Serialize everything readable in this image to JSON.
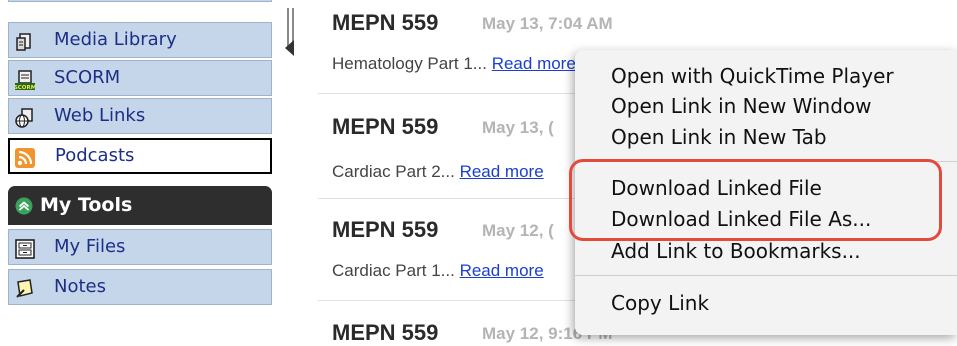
{
  "sidebar": {
    "items": [
      {
        "label": "Media Library",
        "icon": "media-library-icon"
      },
      {
        "label": "SCORM",
        "icon": "scorm-icon"
      },
      {
        "label": "Web Links",
        "icon": "web-links-icon"
      },
      {
        "label": "Podcasts",
        "icon": "rss-icon"
      }
    ],
    "tools_header": "My Tools",
    "tools": [
      {
        "label": "My Files",
        "icon": "files-icon"
      },
      {
        "label": "Notes",
        "icon": "notes-icon"
      }
    ]
  },
  "posts": [
    {
      "title": "MEPN 559",
      "date": "May 13, 7:04 AM",
      "desc": "Hematology Part 1...",
      "read": "Read more"
    },
    {
      "title": "MEPN 559",
      "date": "May 13, (",
      "desc": "Cardiac Part 2...",
      "read": "Read more"
    },
    {
      "title": "MEPN 559",
      "date": "May 12, (",
      "desc": "Cardiac Part 1...",
      "read": "Read more"
    },
    {
      "title": "MEPN 559",
      "date": "May 12, 9:16 PM",
      "desc": "",
      "read": ""
    }
  ],
  "context_menu": {
    "items": [
      "Open with QuickTime Player",
      "Open Link in New Window",
      "Open Link in New Tab",
      "Download Linked File",
      "Download Linked File As...",
      "Add Link to Bookmarks...",
      "Copy Link"
    ]
  },
  "colors": {
    "accent_highlight": "#e24b3b",
    "sidebar_bg": "#c5d5ea",
    "link": "#1a3fcf"
  }
}
